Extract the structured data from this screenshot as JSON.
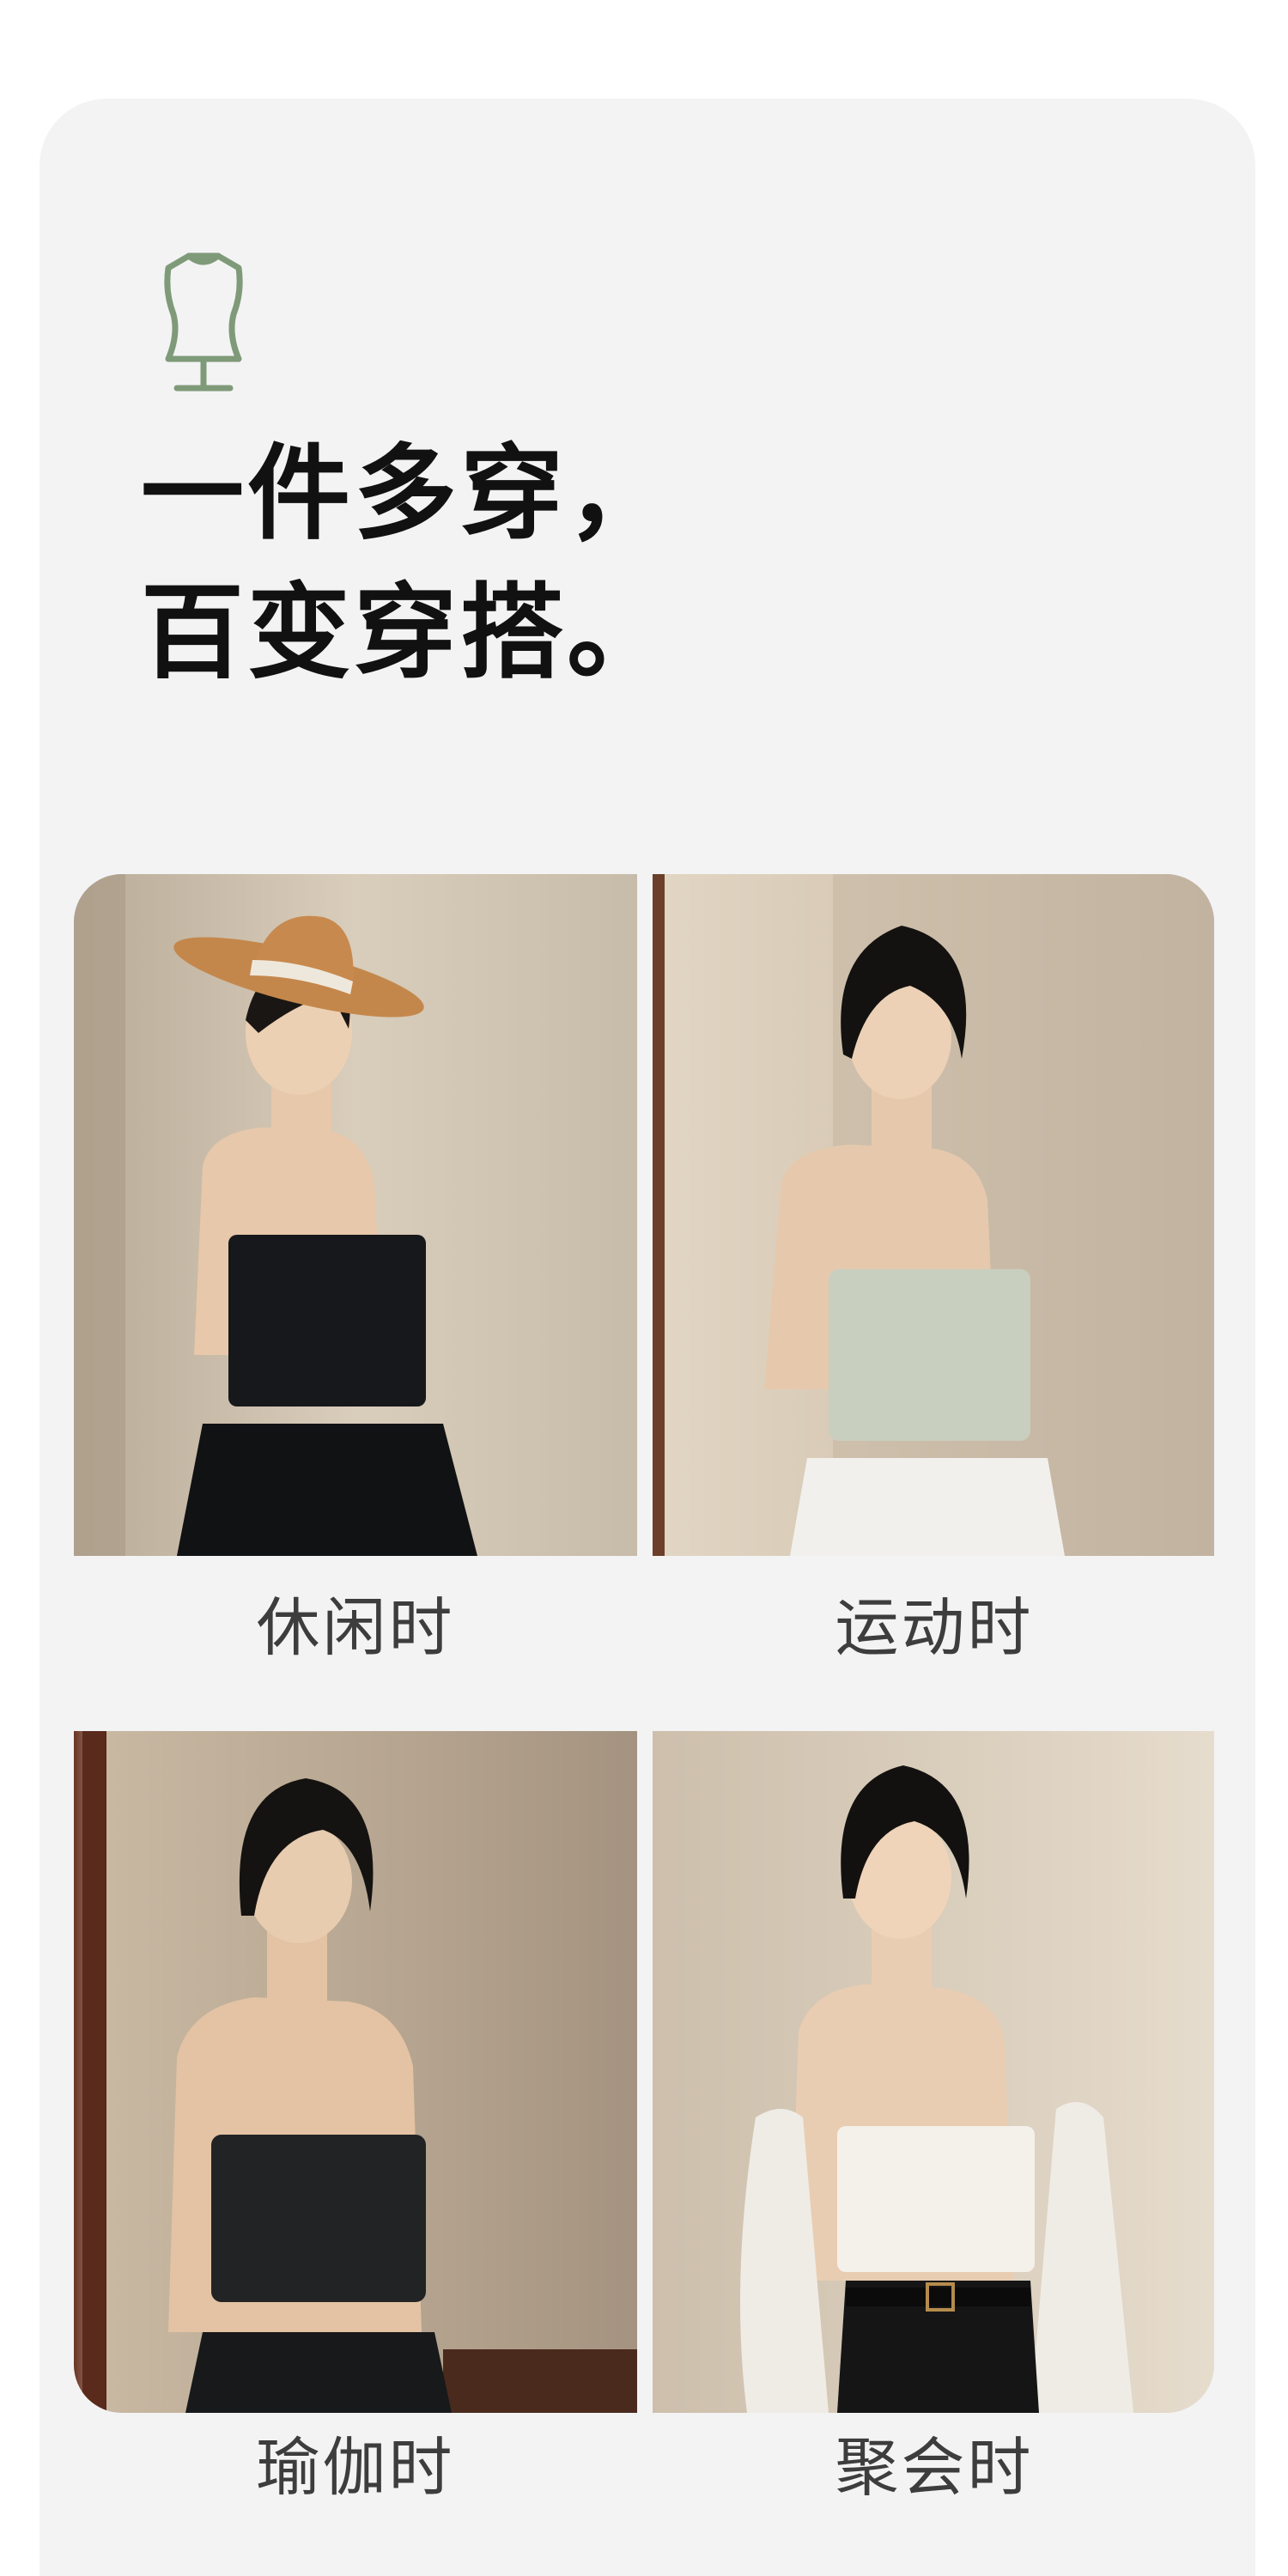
{
  "icon": "mannequin-icon",
  "colors": {
    "accent": "#7f9a78",
    "card_bg": "#f3f3f4",
    "headline": "#111111",
    "caption": "#3d3d3d"
  },
  "headline": {
    "line1": "一件多穿，",
    "line2": "百变穿搭。"
  },
  "looks": [
    {
      "label": "休闲时",
      "top_color": "#16181b",
      "bottom_color": "#111214",
      "hat": true
    },
    {
      "label": "运动时",
      "top_color": "#c9cfbf",
      "bottom_color": "#f1f0ec",
      "hat": false
    },
    {
      "label": "瑜伽时",
      "top_color": "#222325",
      "bottom_color": "#18191b",
      "hat": false
    },
    {
      "label": "聚会时",
      "top_color": "#f4f1ea",
      "bottom_color": "#151515",
      "hat": false
    }
  ]
}
